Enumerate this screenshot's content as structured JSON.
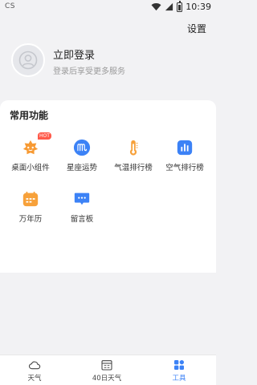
{
  "status_bar": {
    "left_label": "CS",
    "time": "10:39"
  },
  "header": {
    "settings_label": "设置"
  },
  "profile": {
    "login_title": "立即登录",
    "login_subtitle": "登录后享受更多服务"
  },
  "common_functions": {
    "title": "常用功能",
    "items": [
      {
        "label": "桌面小组件",
        "icon": "widget-icon",
        "badge": "HOT",
        "color": "#f79a33"
      },
      {
        "label": "星座运势",
        "icon": "zodiac-icon",
        "color": "#3c82f6"
      },
      {
        "label": "气温排行榜",
        "icon": "thermometer-icon",
        "color": "#f7a13a"
      },
      {
        "label": "空气排行榜",
        "icon": "air-ranking-icon",
        "color": "#3c82f6"
      },
      {
        "label": "万年历",
        "icon": "calendar-icon",
        "color": "#f7a13a"
      },
      {
        "label": "留言板",
        "icon": "message-board-icon",
        "color": "#3c82f6"
      }
    ]
  },
  "tabbar": {
    "tabs": [
      {
        "label": "天气",
        "icon": "cloud-icon",
        "active": false
      },
      {
        "label": "40日天气",
        "icon": "calendar-40-icon",
        "active": false
      },
      {
        "label": "工具",
        "icon": "tools-icon",
        "active": true
      }
    ]
  },
  "colors": {
    "accent": "#3c82f6",
    "orange": "#f7a13a",
    "background": "#f2f2f4"
  }
}
